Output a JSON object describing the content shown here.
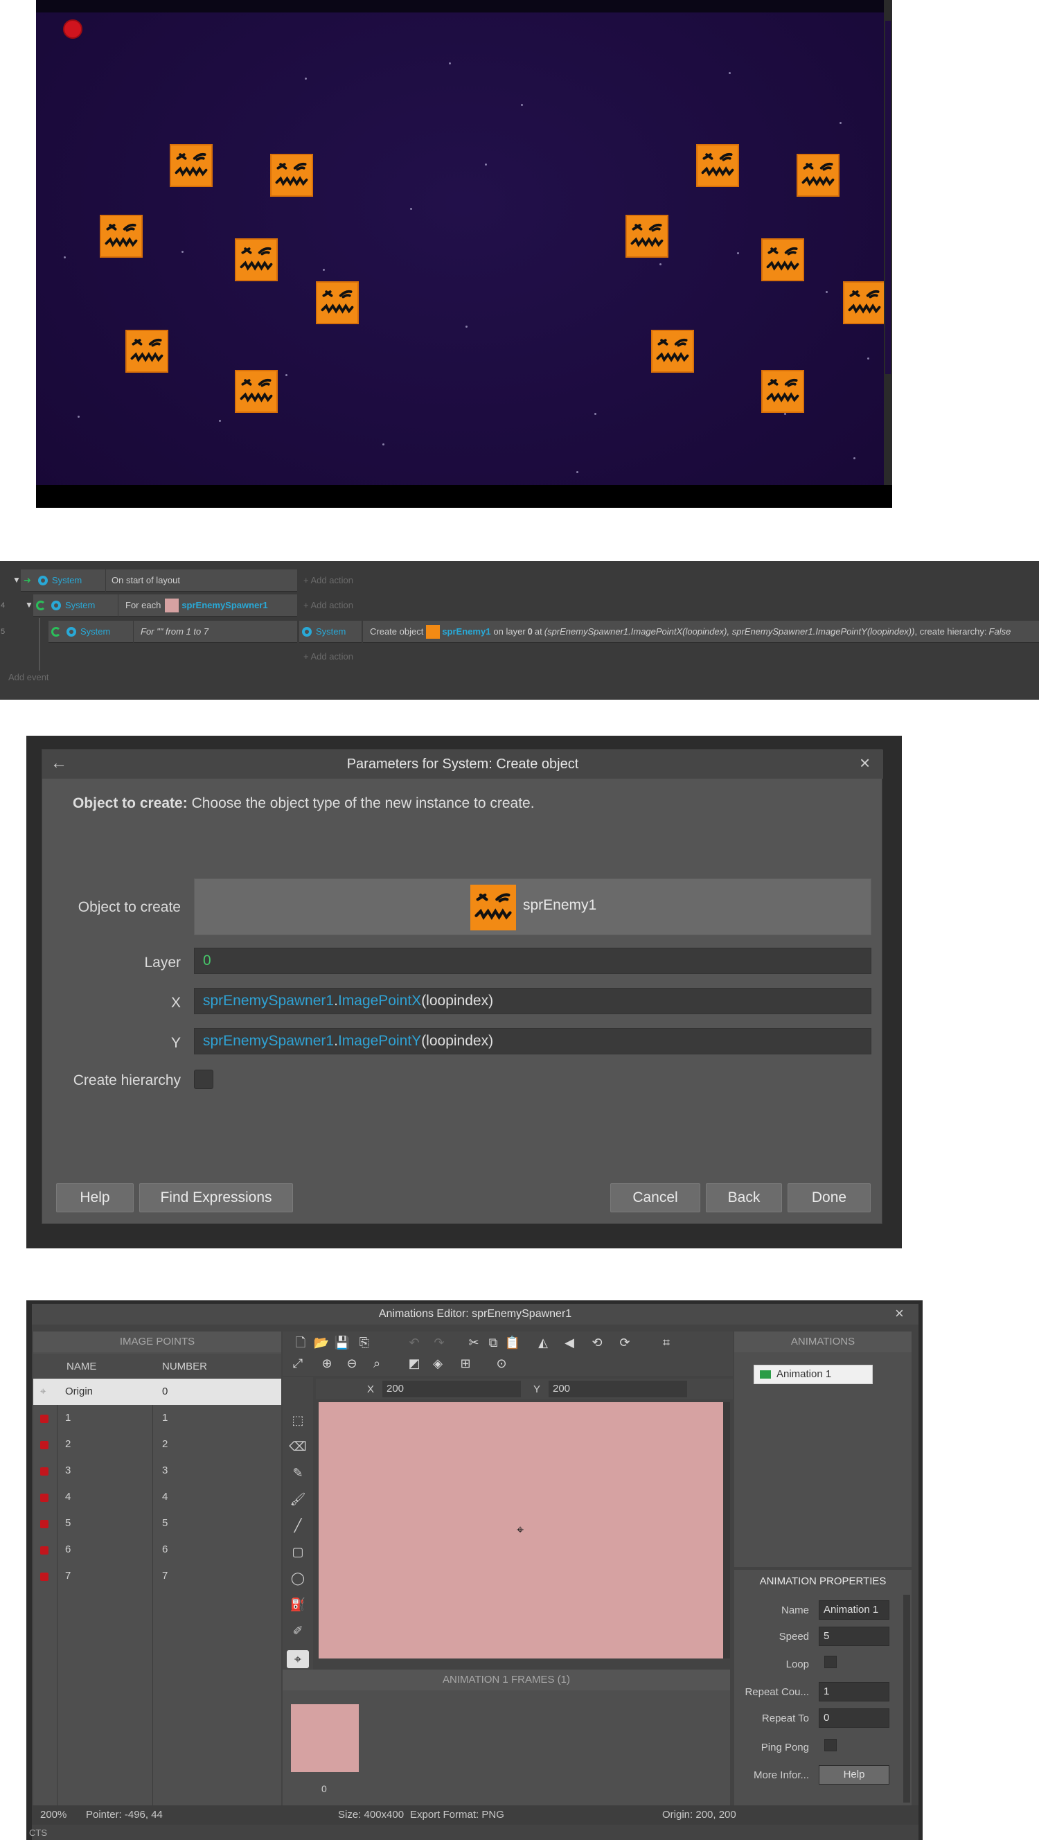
{
  "events": {
    "rows": [
      {
        "num": "",
        "object": "System",
        "condition": "On start of layout",
        "add_action": "+ Add action"
      },
      {
        "num": "4",
        "object": "System",
        "condition_prefix": "For each",
        "condition_object": "sprEnemySpawner1",
        "add_action": "+ Add action"
      },
      {
        "num": "5",
        "object": "System",
        "condition": "For \"\" from 1 to 7",
        "action_object": "System",
        "action_prefix": "Create object",
        "action_target": "sprEnemy1",
        "action_mid": "on layer",
        "action_layer": "0",
        "action_at": "at",
        "action_expr": "(sprEnemySpawner1.ImagePointX(loopindex), sprEnemySpawner1.ImagePointY(loopindex))",
        "action_tail": ", create hierarchy:",
        "action_false": "False",
        "add_action": "+ Add action"
      }
    ],
    "add_event": "Add event"
  },
  "dialog": {
    "title": "Parameters for System: Create object",
    "desc_bold": "Object to create:",
    "desc": "Choose the object type of the new instance to create.",
    "labels": {
      "object": "Object to create",
      "layer": "Layer",
      "x": "X",
      "y": "Y",
      "hierarchy": "Create hierarchy"
    },
    "object_value": "sprEnemy1",
    "layer_value": "0",
    "x_obj": "sprEnemySpawner1",
    "x_dot": ".",
    "x_fn": "ImagePointX",
    "x_arg": "(loopindex)",
    "y_obj": "sprEnemySpawner1",
    "y_dot": ".",
    "y_fn": "ImagePointY",
    "y_arg": "(loopindex)",
    "buttons": {
      "help": "Help",
      "find": "Find Expressions",
      "cancel": "Cancel",
      "back": "Back",
      "done": "Done"
    }
  },
  "anim": {
    "title": "Animations Editor: sprEnemySpawner1",
    "image_points": {
      "header": "IMAGE POINTS",
      "col_name": "NAME",
      "col_number": "NUMBER",
      "rows": [
        {
          "name": "Origin",
          "number": "0"
        },
        {
          "name": "1",
          "number": "1"
        },
        {
          "name": "2",
          "number": "2"
        },
        {
          "name": "3",
          "number": "3"
        },
        {
          "name": "4",
          "number": "4"
        },
        {
          "name": "5",
          "number": "5"
        },
        {
          "name": "6",
          "number": "6"
        },
        {
          "name": "7",
          "number": "7"
        }
      ]
    },
    "coords": {
      "x_label": "X",
      "x_value": "200",
      "y_label": "Y",
      "y_value": "200"
    },
    "frames": {
      "header": "ANIMATION 1 FRAMES (1)",
      "frame_index": "0"
    },
    "animations": {
      "header": "ANIMATIONS",
      "items": [
        "Animation 1"
      ]
    },
    "properties": {
      "header": "ANIMATION PROPERTIES",
      "name_label": "Name",
      "name_value": "Animation 1",
      "speed_label": "Speed",
      "speed_value": "5",
      "loop_label": "Loop",
      "repeat_count_label": "Repeat Cou...",
      "repeat_count_value": "1",
      "repeat_to_label": "Repeat To",
      "repeat_to_value": "0",
      "pingpong_label": "Ping Pong",
      "more_label": "More Infor...",
      "help_button": "Help"
    },
    "status": {
      "zoom": "200%",
      "pointer": "Pointer: -496, 44",
      "size": "Size: 400x400",
      "format": "Export Format: PNG",
      "origin": "Origin: 200, 200"
    },
    "footer_fragment": "CTS"
  },
  "colors": {
    "enemy": "#f28a14",
    "spawner": "#d6a2a2",
    "accent": "#2fa2d4",
    "player": "#d0141e"
  }
}
